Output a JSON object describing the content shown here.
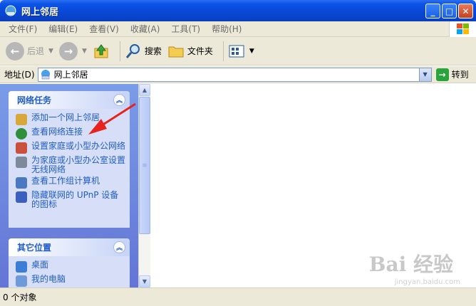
{
  "window": {
    "title": "网上邻居"
  },
  "menu": [
    "文件(F)",
    "编辑(E)",
    "查看(V)",
    "收藏(A)",
    "工具(T)",
    "帮助(H)"
  ],
  "toolbar": {
    "back": "后退",
    "search": "搜索",
    "folders": "文件夹"
  },
  "address": {
    "label": "地址(D)",
    "value": "网上邻居",
    "go": "转到"
  },
  "network_tasks": {
    "title": "网络任务",
    "items": [
      "添加一个网上邻居",
      "查看网络连接",
      "设置家庭或小型办公网络",
      "为家庭或小型办公室设置无线网络",
      "查看工作组计算机",
      "隐藏联网的 UPnP 设备的图标"
    ]
  },
  "other_places": {
    "title": "其它位置",
    "items": [
      "桌面",
      "我的电脑"
    ]
  },
  "status": {
    "objects": "0 个对象"
  },
  "watermark": {
    "logo": "Bai 经验",
    "url": "jingyan.baidu.com"
  }
}
